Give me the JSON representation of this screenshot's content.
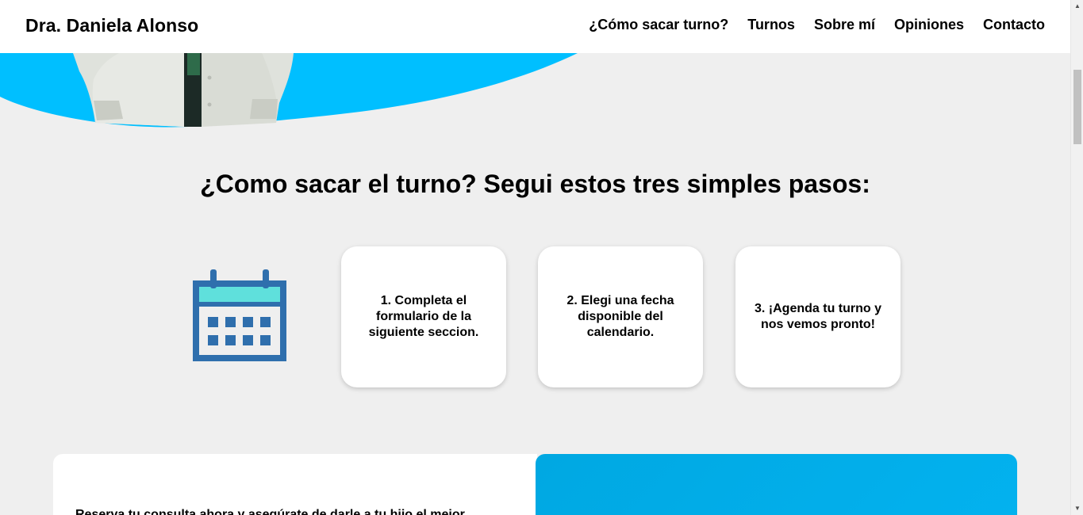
{
  "header": {
    "brand": "Dra. Daniela Alonso",
    "nav": [
      {
        "label": "¿Cómo sacar turno?"
      },
      {
        "label": "Turnos"
      },
      {
        "label": "Sobre mí"
      },
      {
        "label": "Opiniones"
      },
      {
        "label": "Contacto"
      }
    ]
  },
  "section": {
    "title": "¿Como sacar el turno? Segui estos tres simples pasos:",
    "icon": "calendar-icon",
    "steps": [
      {
        "text": "1. Completa el formulario de la siguiente seccion."
      },
      {
        "text": "2. Elegi una fecha disponible del calendario."
      },
      {
        "text": "3. ¡Agenda tu turno y nos vemos pronto!"
      }
    ]
  },
  "booking": {
    "text": "Reserva tu consulta ahora y asegúrate de darle a tu hijo el mejor"
  },
  "colors": {
    "accent": "#00bfff",
    "calendar_blue": "#2f6fad",
    "calendar_header": "#5fe0dc",
    "booking_blue": "#00a8e2"
  }
}
